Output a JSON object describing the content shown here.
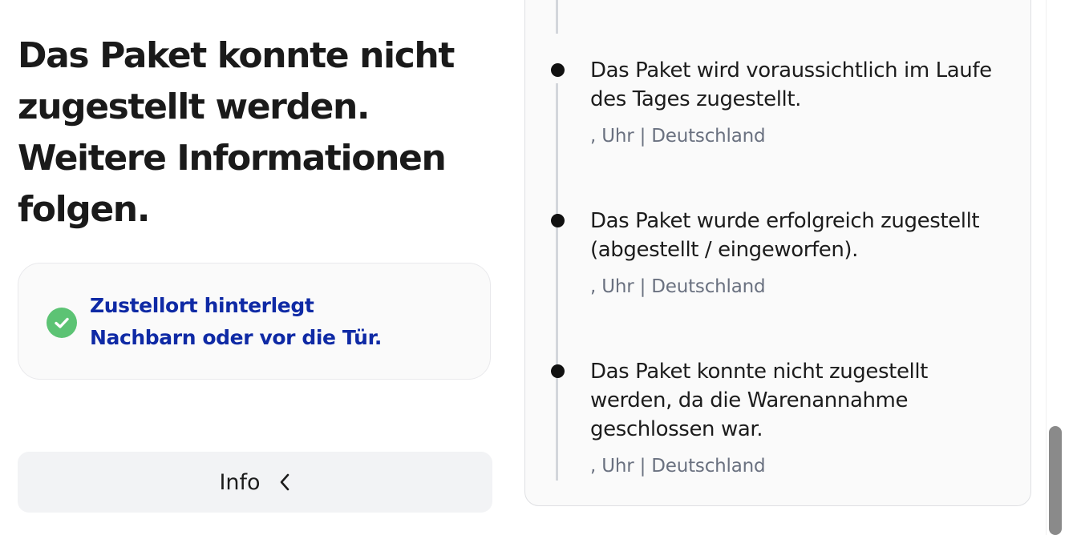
{
  "status": {
    "headline": "Das Paket konnte nicht zugestellt werden. Weitere Informationen folgen."
  },
  "delivery_preference": {
    "line1": "Zustellort hinterlegt",
    "line2": "Nachbarn oder vor die Tür.",
    "icon": "check-circle-icon",
    "icon_color": "#5cc374",
    "text_color": "#0f2aa5"
  },
  "info_button": {
    "label": "Info",
    "icon": "chevron-left-icon"
  },
  "timeline": {
    "events": [
      {
        "text": "Das Paket wird voraussichtlich im Laufe des Tages zugestellt.",
        "meta": ", Uhr | Deutschland"
      },
      {
        "text": "Das Paket wurde erfolgreich zugestellt (abgestellt / eingeworfen).",
        "meta": ", Uhr | Deutschland"
      },
      {
        "text": "Das Paket konnte nicht zugestellt werden, da die Warenannahme geschlossen war.",
        "meta": ", Uhr | Deutschland"
      }
    ]
  }
}
